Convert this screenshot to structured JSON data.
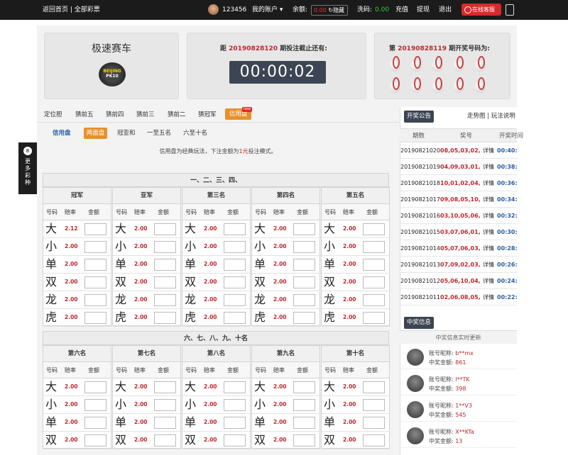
{
  "header": {
    "links": "返回首页 | 全部彩票",
    "username": "123456",
    "account_menu": "我的账户 ▾",
    "balance_label": "余额:",
    "balance_value": "0.00",
    "hide_label": "隐藏",
    "wash_label": "洗码:",
    "wash_value": "0.00",
    "recharge": "充值",
    "withdraw": "提现",
    "logout": "退出",
    "support": "在线客服"
  },
  "side_button": {
    "ball": "8",
    "chars": [
      "更",
      "多",
      "彩",
      "种"
    ]
  },
  "game": {
    "name": "极速赛车",
    "logo_line1": "BEIJING",
    "logo_line2": "PK10",
    "countdown_prefix": "距",
    "current_period": "20190828120",
    "countdown_suffix": "期投注截止还有:",
    "timer": "00:00:02",
    "last_prefix": "第",
    "last_period": "20190828119",
    "last_suffix": "期开奖号码为:"
  },
  "tabs": [
    "定位胆",
    "猜前五",
    "猜前四",
    "猜前三",
    "猜前二",
    "猜冠军",
    "信用盘"
  ],
  "new_badge": "new",
  "sub_tabs": {
    "label": "信用盘",
    "items": [
      "两面盘",
      "冠亚和",
      "一至五名",
      "六至十名"
    ]
  },
  "note": {
    "pre": "信用盘为经典玩法，下注金额为",
    "hl": "1元",
    "post": "投注模式。"
  },
  "section1": {
    "title": "一、二、三、四、",
    "groups": [
      {
        "name": "冠军",
        "odds": [
          "2.12",
          "2.00",
          "2.00",
          "2.00",
          "2.00",
          "2.00"
        ]
      },
      {
        "name": "亚军",
        "odds": [
          "2.00",
          "2.00",
          "2.00",
          "2.00",
          "2.00",
          "2.00"
        ]
      },
      {
        "name": "第三名",
        "odds": [
          "2.00",
          "2.00",
          "2.00",
          "2.00",
          "2.00",
          "2.00"
        ]
      },
      {
        "name": "第四名",
        "odds": [
          "2.00",
          "2.00",
          "2.00",
          "2.00",
          "2.00",
          "2.00"
        ]
      },
      {
        "name": "第五名",
        "odds": [
          "2.00",
          "2.00",
          "2.00",
          "2.00",
          "2.00",
          "2.00"
        ]
      }
    ]
  },
  "section2": {
    "title": "六、七、八、九、十名",
    "groups": [
      {
        "name": "第六名",
        "odds": [
          "2.00",
          "2.00",
          "2.00",
          "2.00"
        ]
      },
      {
        "name": "第七名",
        "odds": [
          "2.00",
          "2.00",
          "2.00",
          "2.00"
        ]
      },
      {
        "name": "第八名",
        "odds": [
          "2.00",
          "2.00",
          "2.00",
          "2.00"
        ]
      },
      {
        "name": "第九名",
        "odds": [
          "2.00",
          "2.00",
          "2.00",
          "2.00"
        ]
      },
      {
        "name": "第十名",
        "odds": [
          "2.00",
          "2.00",
          "2.00",
          "2.00"
        ]
      }
    ]
  },
  "col_headers": [
    "号码",
    "赔率",
    "金额"
  ],
  "bet_symbols": [
    "大",
    "小",
    "单",
    "双",
    "龙",
    "虎"
  ],
  "right": {
    "announcement": "开奖公告",
    "trend_links": "走势图 | 玩法说明",
    "history_headers": [
      "期数",
      "奖号",
      "开奖时间"
    ],
    "history": [
      {
        "period": "20190821020",
        "nums": "08,05,03,02,",
        "detail": "详情",
        "time": "00:40:0"
      },
      {
        "period": "20190821019",
        "nums": "04,09,03,01,",
        "detail": "详情",
        "time": "00:38:0"
      },
      {
        "period": "20190821018",
        "nums": "10,01,02,04,",
        "detail": "详情",
        "time": "00:36:0"
      },
      {
        "period": "20190821017",
        "nums": "09,08,05,10,",
        "detail": "详情",
        "time": "00:34:0"
      },
      {
        "period": "20190821016",
        "nums": "03,10,05,06,",
        "detail": "详情",
        "time": "00:32:0"
      },
      {
        "period": "20190821015",
        "nums": "03,07,06,01,",
        "detail": "详情",
        "time": "00:30:0"
      },
      {
        "period": "20190821014",
        "nums": "05,07,06,03,",
        "detail": "详情",
        "time": "00:28:0"
      },
      {
        "period": "20190821013",
        "nums": "07,09,02,03,",
        "detail": "详情",
        "time": "00:26:0"
      },
      {
        "period": "20190821012",
        "nums": "05,06,10,04,",
        "detail": "详情",
        "time": "00:24:0"
      },
      {
        "period": "20190821011",
        "nums": "02,06,08,05,",
        "detail": "详情",
        "time": "00:22:0"
      }
    ],
    "winners_title": "中奖信息",
    "winners_live": "中奖信息实时更新",
    "account_label": "账号昵称:",
    "amount_label": "中奖金额:",
    "winners": [
      {
        "name": "b**mx",
        "amount": "861"
      },
      {
        "name": "l**TK",
        "amount": "398"
      },
      {
        "name": "1**V3",
        "amount": "545"
      },
      {
        "name": "X**KTa",
        "amount": "13"
      }
    ]
  }
}
